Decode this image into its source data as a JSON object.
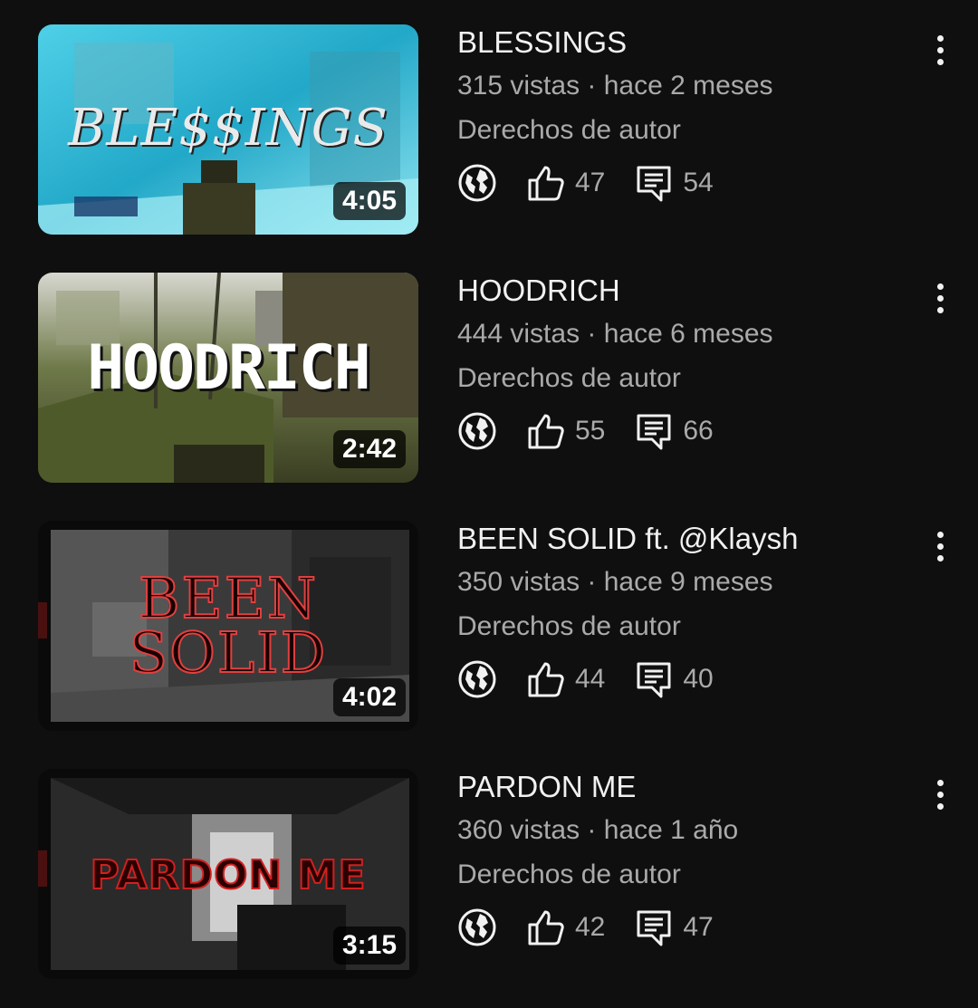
{
  "videos": [
    {
      "title": "BLESSINGS",
      "views": "315 vistas",
      "age": "hace 2 meses",
      "rights": "Derechos de autor",
      "duration": "4:05",
      "likes": "47",
      "comments": "54",
      "thumb_text": "BLE$$INGS",
      "thumb_style": "cyan"
    },
    {
      "title": "HOODRICH",
      "views": "444 vistas",
      "age": "hace 6 meses",
      "rights": "Derechos de autor",
      "duration": "2:42",
      "likes": "55",
      "comments": "66",
      "thumb_text": "HOODRICH",
      "thumb_style": "olive"
    },
    {
      "title": "BEEN SOLID ft. @Klaysh",
      "views": "350 vistas",
      "age": "hace 9 meses",
      "rights": "Derechos de autor",
      "duration": "4:02",
      "likes": "44",
      "comments": "40",
      "thumb_text": "BEEN SOLID",
      "thumb_style": "dark-red"
    },
    {
      "title": "PARDON ME",
      "views": "360 vistas",
      "age": "hace 1 año",
      "rights": "Derechos de autor",
      "duration": "3:15",
      "likes": "42",
      "comments": "47",
      "thumb_text": "PARDON ME",
      "thumb_style": "dark-red2"
    }
  ],
  "icons": {
    "visibility": "globe-icon",
    "likes": "thumbs-up-icon",
    "comments": "comment-icon",
    "menu": "more-vert-icon"
  },
  "colors": {
    "background": "#0f0f0f",
    "primary_text": "#f1f1f1",
    "secondary_text": "#aaaaaa"
  }
}
